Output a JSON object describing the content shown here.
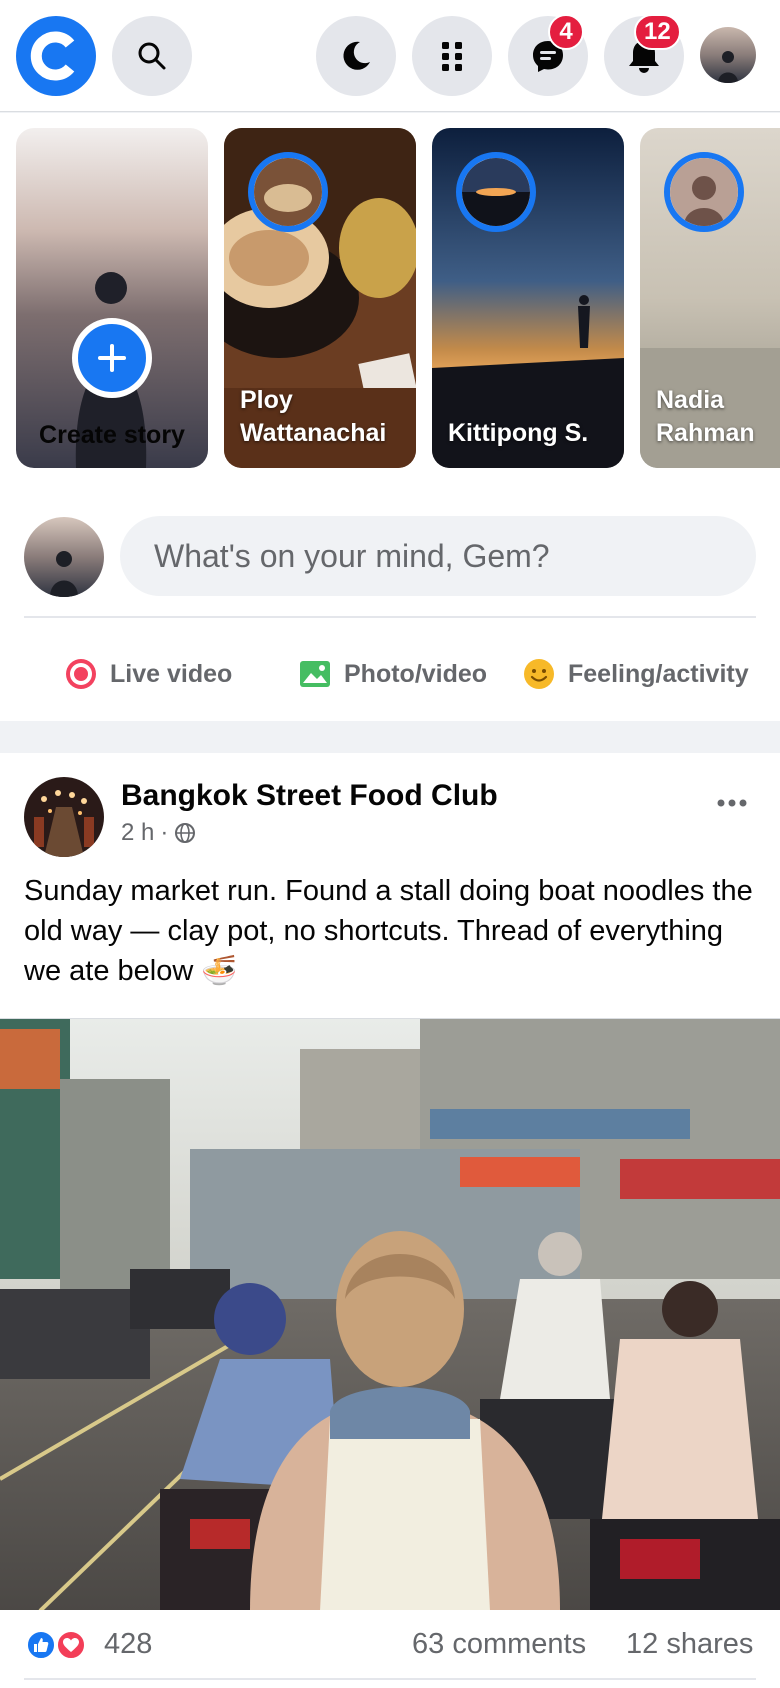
{
  "app": {
    "brand_color": "#1877f2",
    "logo_icon": "app-logo-c"
  },
  "topbar": {
    "search_icon": "search-icon",
    "dark_mode_icon": "moon-icon",
    "menu_icon": "grid-menu-icon",
    "messages_badge": "4",
    "notifications_badge": "12",
    "badge_color": "#e41e3f"
  },
  "stories": {
    "create_label": "Create story",
    "items": [
      {
        "name": "Ploy\nWattanachai"
      },
      {
        "name": "Kittipong S."
      },
      {
        "name": "Nadia\nRahman"
      }
    ]
  },
  "composer": {
    "placeholder": "What's on your mind, Gem?",
    "actions": [
      {
        "label": "Live video",
        "icon": "live-video-icon",
        "color": "#f3425f"
      },
      {
        "label": "Photo/video",
        "icon": "photo-icon",
        "color": "#45bd62"
      },
      {
        "label": "Feeling/activity",
        "icon": "feeling-icon",
        "color": "#f7b928"
      }
    ]
  },
  "post": {
    "author": "Bangkok Street Food Club",
    "time": "2 h",
    "separator": "·",
    "privacy_icon": "globe-icon",
    "text": "Sunday market run. Found a stall doing boat noodles the old way — clay pot, no shortcuts. Thread of everything we ate below 🍜",
    "reactions_count": "428",
    "comments": "63 comments",
    "shares": "12 shares"
  }
}
